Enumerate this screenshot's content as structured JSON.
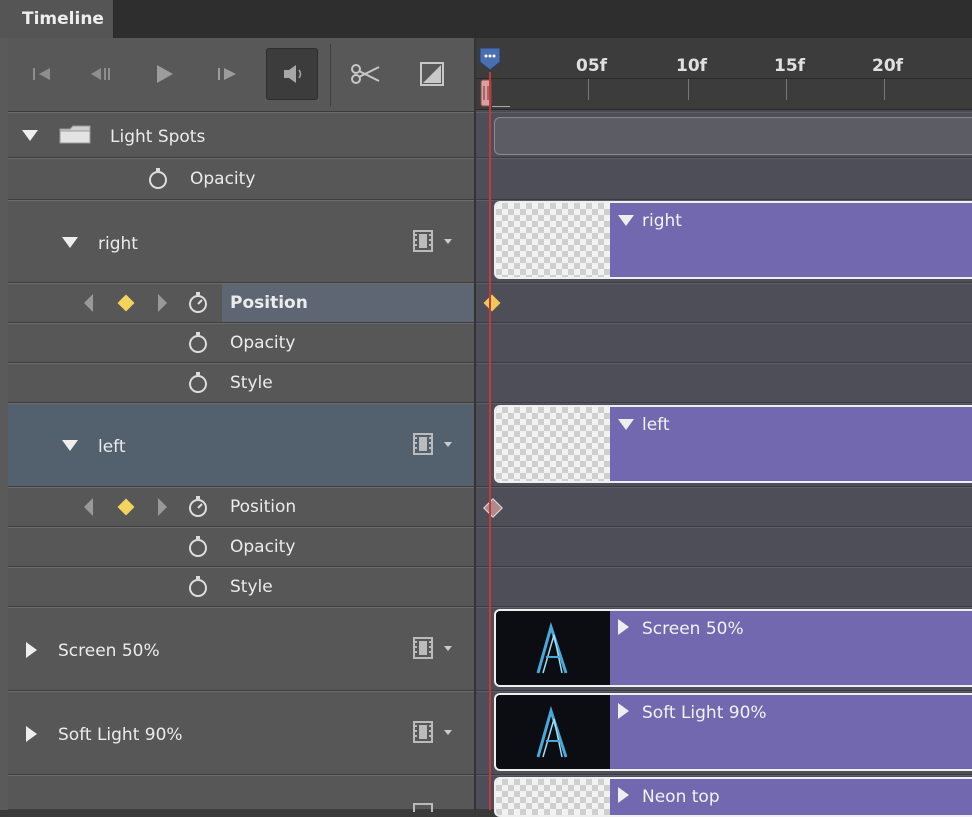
{
  "panel_title": "Timeline",
  "toolbar": {
    "icons": [
      "skip-to-start-icon",
      "step-back-icon",
      "play-icon",
      "step-forward-icon",
      "audio-icon",
      "scissors-icon",
      "transition-icon"
    ]
  },
  "ruler": {
    "ticks": [
      "05f",
      "10f",
      "15f",
      "20f"
    ]
  },
  "layers": {
    "group": {
      "name": "Light Spots",
      "prop": "Opacity"
    },
    "right": {
      "name": "right",
      "props": [
        "Position",
        "Opacity",
        "Style"
      ]
    },
    "left": {
      "name": "left",
      "props": [
        "Position",
        "Opacity",
        "Style"
      ]
    },
    "screen": {
      "name": "Screen 50%"
    },
    "softlight": {
      "name": "Soft Light 90%"
    }
  },
  "clips": {
    "right": "right",
    "left": "left",
    "screen": "Screen 50%",
    "softlight": "Soft Light 90%",
    "neon": "Neon top"
  },
  "colors": {
    "clip": "#7268b0",
    "playhead": "#c23a3a",
    "keyframe": "#f2d35b",
    "selected_row": "#53606e"
  }
}
